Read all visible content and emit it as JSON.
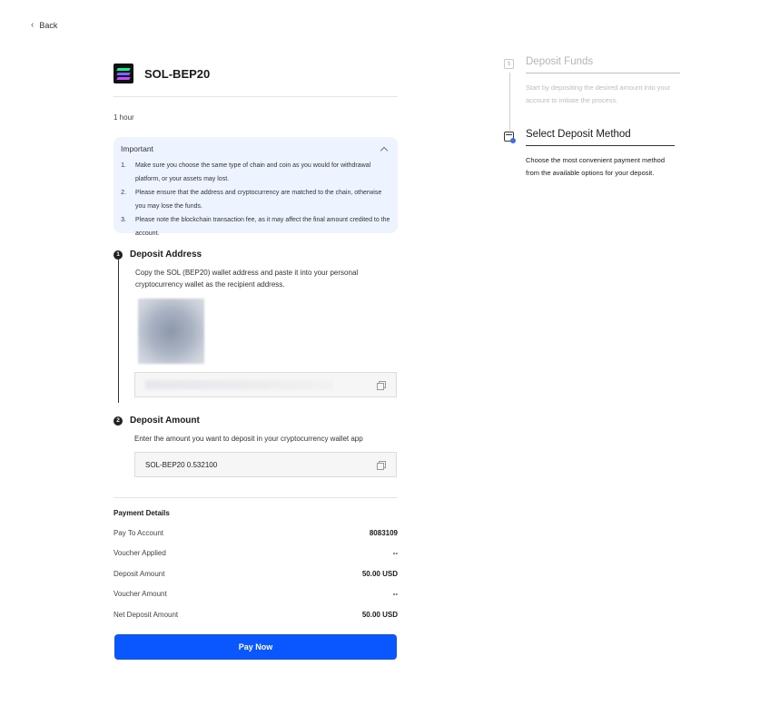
{
  "nav": {
    "back_label": "Back"
  },
  "coin": {
    "name": "SOL-BEP20"
  },
  "timeframe": "1 hour",
  "important": {
    "title": "Important",
    "items": [
      {
        "num": "1.",
        "text": "Make sure you choose the same type of chain and coin as you would for withdrawal platform, or your assets may lost."
      },
      {
        "num": "2.",
        "text": "Please ensure that the address and cryptocurrency are matched to the chain, otherwise you may lose the funds."
      },
      {
        "num": "3.",
        "text": "Please note the blockchain transaction fee, as it may affect the final amount credited to the account."
      }
    ]
  },
  "steps": {
    "address": {
      "num": "1",
      "title": "Deposit Address",
      "desc": "Copy the SOL (BEP20) wallet address and paste it into your personal cryptocurrency wallet as the recipient address."
    },
    "amount": {
      "num": "2",
      "title": "Deposit Amount",
      "desc": "Enter the amount you want to deposit in your cryptocurrency wallet app",
      "value": "SOL-BEP20 0.532100"
    }
  },
  "payment": {
    "title": "Payment Details",
    "rows": [
      {
        "label": "Pay To Account",
        "value": "8083109"
      },
      {
        "label": "Voucher Applied",
        "value": "--"
      },
      {
        "label": "Deposit Amount",
        "value": "50.00 USD"
      },
      {
        "label": "Voucher Amount",
        "value": "--"
      },
      {
        "label": "Net Deposit Amount",
        "value": "50.00 USD"
      }
    ],
    "button_label": "Pay Now"
  },
  "sidebar": {
    "steps": [
      {
        "title": "Deposit Funds",
        "desc": "Start by depositing the desired amount into your account to initiate the process.",
        "icon": "$"
      },
      {
        "title": "Select Deposit Method",
        "desc": "Choose the most convenient payment method from the available options for your deposit."
      }
    ]
  },
  "colors": {
    "primary": "#0b57ff",
    "notice_bg": "#eef4ff"
  }
}
